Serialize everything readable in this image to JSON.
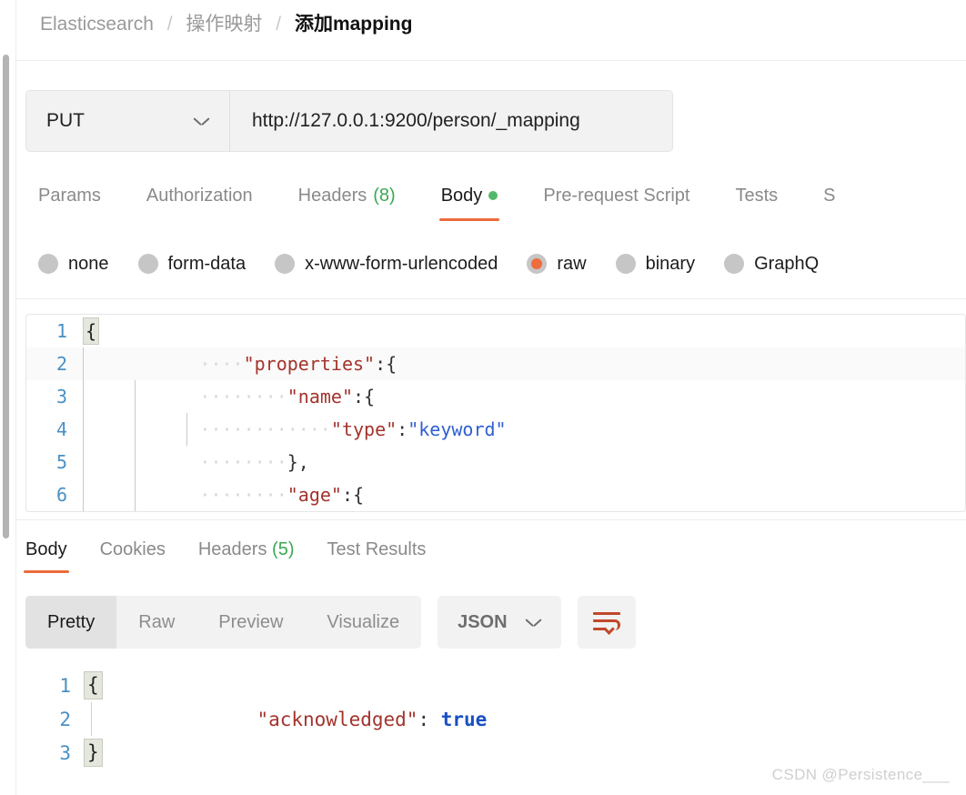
{
  "breadcrumb": {
    "root": "Elasticsearch",
    "sep": "/",
    "folder": "操作映射",
    "current": "添加mapping"
  },
  "request": {
    "method": "PUT",
    "method_icon": "chevron-down-icon",
    "url": "http://127.0.0.1:9200/person/_mapping",
    "tabs": [
      {
        "label": "Params",
        "active": false
      },
      {
        "label": "Authorization",
        "active": false
      },
      {
        "label": "Headers",
        "count": "(8)",
        "active": false
      },
      {
        "label": "Body",
        "active": true,
        "dot": true
      },
      {
        "label": "Pre-request Script",
        "active": false
      },
      {
        "label": "Tests",
        "active": false
      },
      {
        "label": "S",
        "active": false
      }
    ],
    "body_types": [
      {
        "label": "none",
        "selected": false
      },
      {
        "label": "form-data",
        "selected": false
      },
      {
        "label": "x-www-form-urlencoded",
        "selected": false
      },
      {
        "label": "raw",
        "selected": true
      },
      {
        "label": "binary",
        "selected": false
      },
      {
        "label": "GraphQ",
        "selected": false
      }
    ],
    "editor": {
      "lines": [
        {
          "no": "1",
          "indent": "",
          "text": "",
          "fold": "{",
          "depth": 0
        },
        {
          "no": "2",
          "indent": "····",
          "key": "\"properties\"",
          "punc": ":{",
          "depth": 1
        },
        {
          "no": "3",
          "indent": "········",
          "key": "\"name\"",
          "punc": ":{",
          "depth": 2
        },
        {
          "no": "4",
          "indent": "············",
          "key": "\"type\"",
          "punc": ":",
          "val": "\"keyword\"",
          "depth": 3
        },
        {
          "no": "5",
          "indent": "········",
          "punc": "},",
          "depth": 2
        },
        {
          "no": "6",
          "indent": "········",
          "key": "\"age\"",
          "punc": ":{",
          "depth": 2
        }
      ]
    }
  },
  "response": {
    "tabs": [
      {
        "label": "Body",
        "active": true
      },
      {
        "label": "Cookies",
        "active": false
      },
      {
        "label": "Headers",
        "count": "(5)",
        "active": false
      },
      {
        "label": "Test Results",
        "active": false
      }
    ],
    "view_modes": [
      {
        "label": "Pretty",
        "active": true
      },
      {
        "label": "Raw",
        "active": false
      },
      {
        "label": "Preview",
        "active": false
      },
      {
        "label": "Visualize",
        "active": false
      }
    ],
    "format": "JSON",
    "format_icon": "chevron-down-icon",
    "wrap_icon": "word-wrap-icon",
    "body": {
      "lines": [
        {
          "no": "1",
          "fold": "{",
          "text": ""
        },
        {
          "no": "2",
          "key": "\"acknowledged\"",
          "punc": ": ",
          "bool": "true"
        },
        {
          "no": "3",
          "fold": "}",
          "text": ""
        }
      ]
    }
  },
  "watermark": "CSDN @Persistence___",
  "colors": {
    "accent": "#eb6c3b",
    "green": "#52b86a",
    "key": "#a3342c",
    "value": "#2f5fd0",
    "linenum": "#4a90c4"
  }
}
